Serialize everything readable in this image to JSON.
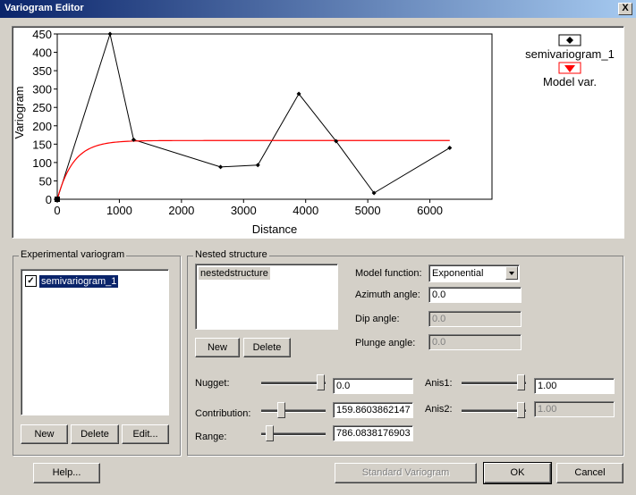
{
  "window": {
    "title": "Variogram Editor",
    "close_glyph": "X"
  },
  "chart_data": {
    "type": "line",
    "xlabel": "Distance",
    "ylabel": "Variogram",
    "xlim": [
      0,
      7000
    ],
    "ylim": [
      0,
      450
    ],
    "x_ticks": [
      "0",
      "1000",
      "2000",
      "3000",
      "4000",
      "5000",
      "6000"
    ],
    "y_ticks": [
      "0",
      "50",
      "100",
      "150",
      "200",
      "250",
      "300",
      "350",
      "400",
      "450"
    ],
    "grid": false,
    "legend_position": "top-right",
    "series": [
      {
        "name": "semivariogram_1",
        "marker": "diamond",
        "color": "#000000",
        "x": [
          0,
          850,
          1230,
          2630,
          3230,
          3890,
          4490,
          5100,
          6320
        ],
        "y": [
          0,
          450,
          162,
          88,
          93,
          287,
          158,
          17,
          140
        ]
      },
      {
        "name": "Model var.",
        "marker": "triangle-down",
        "color": "#ff0000",
        "model": "exponential",
        "nugget": 0.0,
        "sill": 159.8603862147,
        "range": 786.0838176903,
        "x_max": 6320
      }
    ]
  },
  "experimental": {
    "legend": "Experimental variogram",
    "items": [
      {
        "label": "semivariogram_1",
        "checked": true
      }
    ],
    "buttons": {
      "new": "New",
      "delete": "Delete",
      "edit": "Edit..."
    }
  },
  "nested": {
    "legend": "Nested structure",
    "items": [
      "nestedstructure"
    ],
    "buttons": {
      "new": "New",
      "delete": "Delete"
    },
    "model_function_label": "Model function:",
    "model_function_value": "Exponential",
    "azimuth_label": "Azimuth angle:",
    "azimuth_value": "0.0",
    "dip_label": "Dip angle:",
    "dip_value": "0.0",
    "plunge_label": "Plunge angle:",
    "plunge_value": "0.0",
    "nugget_label": "Nugget:",
    "nugget_value": "0.0",
    "contribution_label": "Contribution:",
    "contribution_value": "159.8603862147",
    "range_label": "Range:",
    "range_value": "786.0838176903",
    "anis1_label": "Anis1:",
    "anis1_value": "1.00",
    "anis2_label": "Anis2:",
    "anis2_value": "1.00"
  },
  "footer": {
    "help": "Help...",
    "standard": "Standard  Variogram",
    "ok": "OK",
    "cancel": "Cancel"
  }
}
